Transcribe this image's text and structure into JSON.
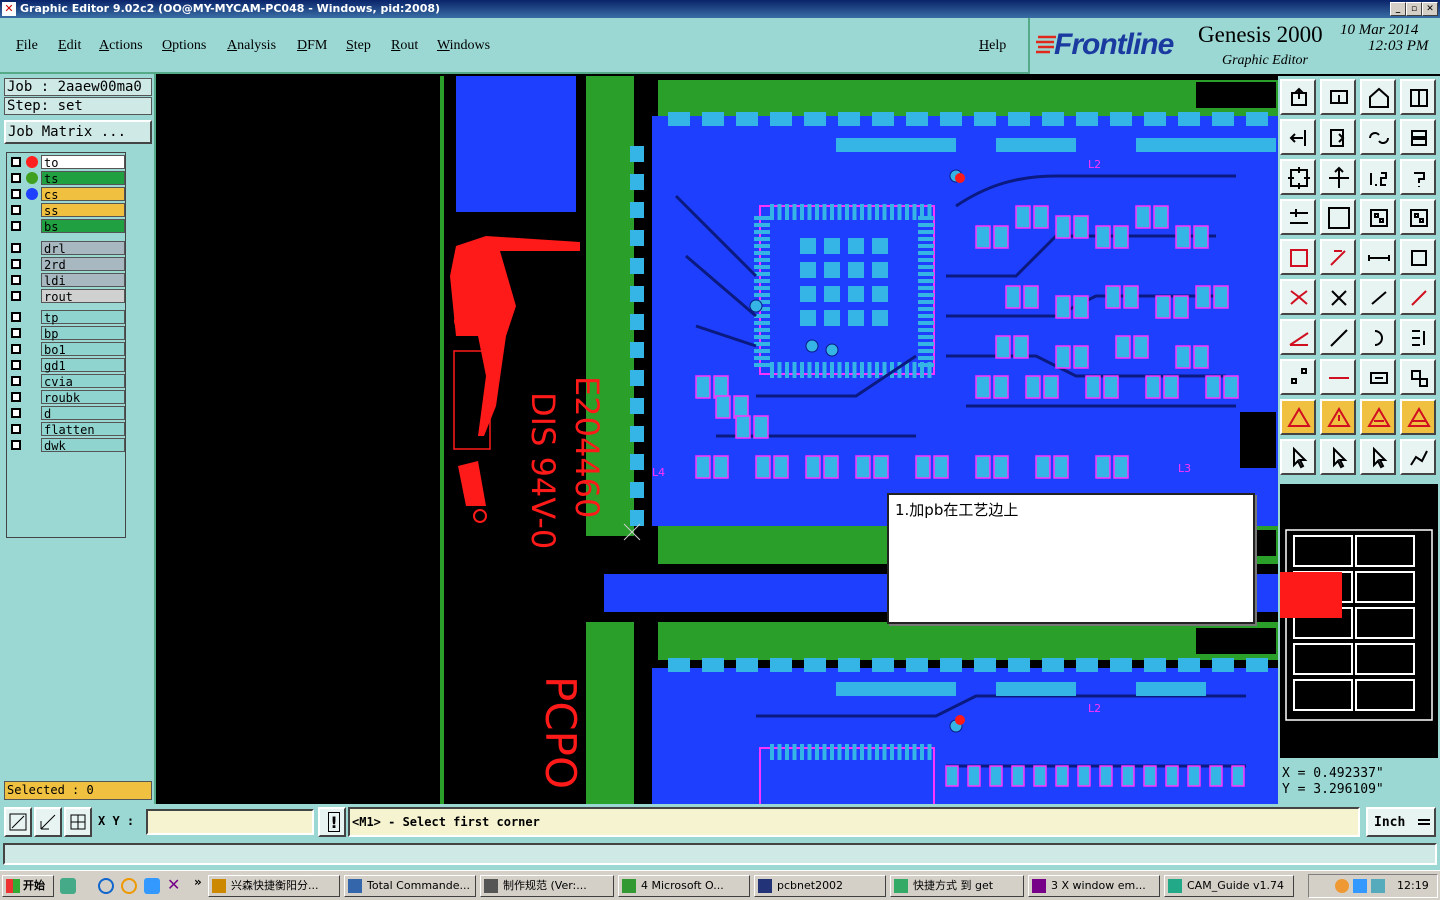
{
  "window": {
    "title": "Graphic Editor 9.02c2 (OO@MY-MYCAM-PC048 - Windows, pid:2008)",
    "controls": [
      "_",
      "▫",
      "✕"
    ]
  },
  "menu": [
    "File",
    "Edit",
    "Actions",
    "Options",
    "Analysis",
    "DFM",
    "Step",
    "Rout",
    "Windows"
  ],
  "help_label": "Help",
  "brand": {
    "logo": "Frontline",
    "product": "Genesis 2000",
    "subtitle": "Graphic Editor",
    "date": "10 Mar 2014",
    "time": "12:03 PM"
  },
  "side": {
    "job": "Job : 2aaew00ma0",
    "step": "Step: set",
    "job_matrix": "Job Matrix ...",
    "selected": "Selected : 0"
  },
  "layers": [
    {
      "name": "to",
      "color": "#ffffff",
      "dot": "#ff2020",
      "box": "#ffffff"
    },
    {
      "name": "ts",
      "color": "#20a040",
      "dot": "#40a020",
      "box": "#20a040"
    },
    {
      "name": "cs",
      "color": "#f0c040",
      "dot": "#2040ff",
      "box": "#f0c040"
    },
    {
      "name": "ss",
      "color": "#f0c040",
      "dot": "",
      "box": "#f0c040"
    },
    {
      "name": "bs",
      "color": "#20a040",
      "dot": "",
      "box": "#20a040"
    },
    {
      "name": "drl",
      "color": "#a8b8c0",
      "dot": "",
      "box": "#a8b8c0"
    },
    {
      "name": "2rd",
      "color": "#a8b8c0",
      "dot": "",
      "box": "#a8b8c0"
    },
    {
      "name": "ldi",
      "color": "#a8b8c0",
      "dot": "",
      "box": "#a8b8c0"
    },
    {
      "name": "rout",
      "color": "#d0d0d0",
      "dot": "",
      "box": "#d0d0d0"
    },
    {
      "name": "tp",
      "color": "#8fd4cf",
      "dot": "",
      "box": "#8fd4cf"
    },
    {
      "name": "bp",
      "color": "#8fd4cf",
      "dot": "",
      "box": "#8fd4cf"
    },
    {
      "name": "bo1",
      "color": "#8fd4cf",
      "dot": "",
      "box": "#8fd4cf"
    },
    {
      "name": "gd1",
      "color": "#8fd4cf",
      "dot": "",
      "box": "#8fd4cf"
    },
    {
      "name": "cvia",
      "color": "#8fd4cf",
      "dot": "",
      "box": "#8fd4cf"
    },
    {
      "name": "roubk",
      "color": "#8fd4cf",
      "dot": "",
      "box": "#8fd4cf"
    },
    {
      "name": "d",
      "color": "#8fd4cf",
      "dot": "",
      "box": "#8fd4cf"
    },
    {
      "name": "flatten",
      "color": "#8fd4cf",
      "dot": "",
      "box": "#8fd4cf"
    },
    {
      "name": "dwk",
      "color": "#8fd4cf",
      "dot": "",
      "box": "#8fd4cf"
    }
  ],
  "canvas": {
    "silk_marks": [
      "E204460",
      "DIS 94V-0",
      "PCPO"
    ],
    "silk_labels": [
      "L2",
      "L3",
      "L4",
      "L2"
    ],
    "note": "1.加pb在工艺边上"
  },
  "coords": {
    "x": "X = 0.492337\"",
    "y": "Y = 3.296109\""
  },
  "bottom": {
    "xy_label": "X Y :",
    "xy_value": "",
    "prompt": "<M1> - Select first corner",
    "units": "Inch",
    "warn_button": "!"
  },
  "taskbar": {
    "start": "开始",
    "items": [
      "兴森快捷衡阳分...",
      "Total Commande...",
      "制作规范 (Ver:...",
      "4 Microsoft O...",
      "pcbnet2002",
      "快捷方式 到 get",
      "3 X window em...",
      "CAM_Guide v1.74"
    ],
    "clock": "12:19"
  },
  "colors": {
    "panel": "#9bd8d3",
    "copper": "#1f3fff",
    "pads": "#35b5e5",
    "board_green": "#2aa02a",
    "silk": "#ff1a1a",
    "trace_magenta": "#ff33ff"
  }
}
